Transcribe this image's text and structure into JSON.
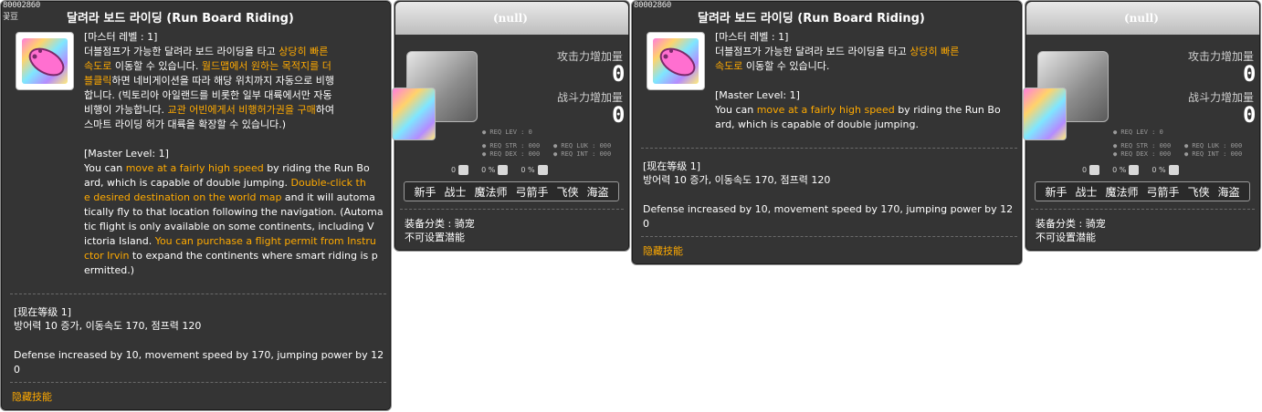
{
  "panels": {
    "skill1": {
      "id_label": "80002860",
      "corner_label": "꽃豆",
      "title": "달려라 보드 라이딩 (Run Board Riding)",
      "desc_lines": [
        [
          {
            "t": "[마스터 레벨 : 1]",
            "h": false
          }
        ],
        [
          {
            "t": "더블점프가 가능한 달려라 보드 라이딩을 타고 ",
            "h": false
          },
          {
            "t": "상당히 빠른",
            "h": true
          }
        ],
        [
          {
            "t": "속도로",
            "h": true
          },
          {
            "t": " 이동할 수 있습니다. ",
            "h": false
          },
          {
            "t": "월드맵에서 원하는 목적지를 더",
            "h": true
          }
        ],
        [
          {
            "t": "블클릭",
            "h": true
          },
          {
            "t": "하면 네비게이션을 따라 해당 위치까지 자동으로 비행",
            "h": false
          }
        ],
        [
          {
            "t": "합니다. (빅토리아 아일랜드를 비롯한 일부 대륙에서만 자동",
            "h": false
          }
        ],
        [
          {
            "t": "비행이 가능합니다. ",
            "h": false
          },
          {
            "t": "교관 어빈에게서 비행허가권을 구매",
            "h": true
          },
          {
            "t": "하여",
            "h": false
          }
        ],
        [
          {
            "t": "스마트 라이딩 허가 대륙을 확장할 수 있습니다.)",
            "h": false
          }
        ],
        [
          {
            "t": "",
            "h": false
          }
        ],
        [
          {
            "t": "[Master Level: 1]",
            "h": false
          }
        ],
        [
          {
            "t": "You can ",
            "h": false
          },
          {
            "t": "move at a fairly high speed",
            "h": true
          },
          {
            "t": " by riding the Run Bo",
            "h": false
          }
        ],
        [
          {
            "t": "ard, which is capable of double jumping. ",
            "h": false
          },
          {
            "t": "Double-click th",
            "h": true
          }
        ],
        [
          {
            "t": "e desired destination on the world map",
            "h": true
          },
          {
            "t": " and it will automa",
            "h": false
          }
        ],
        [
          {
            "t": "tically fly to that location following the navigation. (Automa",
            "h": false
          }
        ],
        [
          {
            "t": "tic flight is only available on some continents, including V",
            "h": false
          }
        ],
        [
          {
            "t": "ictoria Island. ",
            "h": false
          },
          {
            "t": "You can purchase a flight permit from Instru",
            "h": true
          }
        ],
        [
          {
            "t": "ctor Irvin",
            "h": true
          },
          {
            "t": " to expand the continents where smart riding is p",
            "h": false
          }
        ],
        [
          {
            "t": "ermitted.)",
            "h": false
          }
        ]
      ],
      "level_header": "[现在等级 1]",
      "level_kr": "방어력 10 증가, 이동속도 170, 점프력 120",
      "level_en_1": "Defense increased by 10, movement speed by 170, jumping power by 12",
      "level_en_2": "0",
      "hidden_skill": "隐藏技能"
    },
    "equip1": {
      "title": "(null)",
      "attack_label": "攻击力增加量",
      "attack_value": "0",
      "power_label": "战斗力增加量",
      "power_value": "0",
      "req_lev": "● REQ LEV :    0",
      "req_str": "● REQ STR : 000",
      "req_luk": "● REQ LUK : 000",
      "req_dex": "● REQ DEX : 000",
      "req_int": "● REQ INT : 000",
      "icon_row": [
        "0",
        "0 %",
        "0 %"
      ],
      "jobs": [
        "新手",
        "战士",
        "魔法师",
        "弓箭手",
        "飞侠",
        "海盗"
      ],
      "category": "装备分类 : 骑宠",
      "potential": "不可设置潜能"
    },
    "skill2": {
      "id_label": "80002860",
      "title": "달려라 보드 라이딩 (Run Board Riding)",
      "desc_lines": [
        [
          {
            "t": "[마스터 레벨 : 1]",
            "h": false
          }
        ],
        [
          {
            "t": "더블점프가 가능한 달려라 보드 라이딩을 타고 ",
            "h": false
          },
          {
            "t": "상당히 빠른",
            "h": true
          }
        ],
        [
          {
            "t": "속도로",
            "h": true
          },
          {
            "t": " 이동할 수 있습니다.",
            "h": false
          }
        ],
        [
          {
            "t": "",
            "h": false
          }
        ],
        [
          {
            "t": "[Master Level: 1]",
            "h": false
          }
        ],
        [
          {
            "t": "You can ",
            "h": false
          },
          {
            "t": "move at a fairly high speed",
            "h": true
          },
          {
            "t": " by riding the Run Bo",
            "h": false
          }
        ],
        [
          {
            "t": "ard, which is capable of double jumping.",
            "h": false
          }
        ]
      ],
      "level_header": "[现在等级 1]",
      "level_kr": "방어력 10 증가, 이동속도 170, 점프력 120",
      "level_en_1": "Defense increased by 10, movement speed by 170, jumping power by 12",
      "level_en_2": "0",
      "hidden_skill": "隐藏技能"
    },
    "equip2": {
      "title": "(null)",
      "attack_label": "攻击力增加量",
      "attack_value": "0",
      "power_label": "战斗力增加量",
      "power_value": "0",
      "req_lev": "● REQ LEV :    0",
      "req_str": "● REQ STR : 000",
      "req_luk": "● REQ LUK : 000",
      "req_dex": "● REQ DEX : 000",
      "req_int": "● REQ INT : 000",
      "icon_row": [
        "0",
        "0 %",
        "0 %"
      ],
      "jobs": [
        "新手",
        "战士",
        "魔法师",
        "弓箭手",
        "飞侠",
        "海盗"
      ],
      "category": "装备分类 : 骑宠",
      "potential": "不可设置潜能"
    }
  }
}
